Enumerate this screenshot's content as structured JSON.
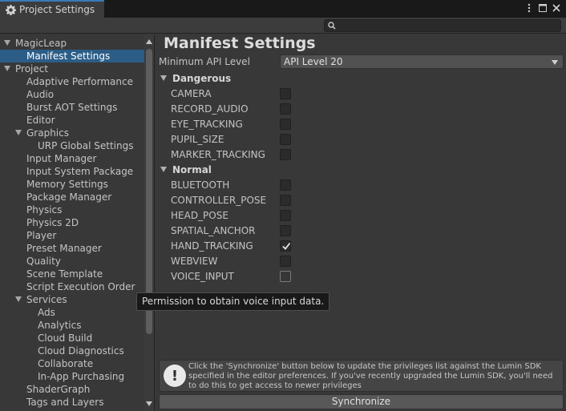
{
  "window": {
    "tab_title": "Project Settings"
  },
  "sidebar": {
    "items": [
      {
        "label": "MagicLeap",
        "indent": 0,
        "arrow": true,
        "selected": false
      },
      {
        "label": "Manifest Settings",
        "indent": 1,
        "arrow": false,
        "selected": true
      },
      {
        "label": "Project",
        "indent": 0,
        "arrow": true,
        "selected": false
      },
      {
        "label": "Adaptive Performance",
        "indent": 1,
        "arrow": false,
        "selected": false
      },
      {
        "label": "Audio",
        "indent": 1,
        "arrow": false,
        "selected": false
      },
      {
        "label": "Burst AOT Settings",
        "indent": 1,
        "arrow": false,
        "selected": false
      },
      {
        "label": "Editor",
        "indent": 1,
        "arrow": false,
        "selected": false
      },
      {
        "label": "Graphics",
        "indent": 1,
        "arrow": true,
        "selected": false
      },
      {
        "label": "URP Global Settings",
        "indent": 2,
        "arrow": false,
        "selected": false
      },
      {
        "label": "Input Manager",
        "indent": 1,
        "arrow": false,
        "selected": false
      },
      {
        "label": "Input System Package",
        "indent": 1,
        "arrow": false,
        "selected": false
      },
      {
        "label": "Memory Settings",
        "indent": 1,
        "arrow": false,
        "selected": false
      },
      {
        "label": "Package Manager",
        "indent": 1,
        "arrow": false,
        "selected": false
      },
      {
        "label": "Physics",
        "indent": 1,
        "arrow": false,
        "selected": false
      },
      {
        "label": "Physics 2D",
        "indent": 1,
        "arrow": false,
        "selected": false
      },
      {
        "label": "Player",
        "indent": 1,
        "arrow": false,
        "selected": false
      },
      {
        "label": "Preset Manager",
        "indent": 1,
        "arrow": false,
        "selected": false
      },
      {
        "label": "Quality",
        "indent": 1,
        "arrow": false,
        "selected": false
      },
      {
        "label": "Scene Template",
        "indent": 1,
        "arrow": false,
        "selected": false
      },
      {
        "label": "Script Execution Order",
        "indent": 1,
        "arrow": false,
        "selected": false
      },
      {
        "label": "Services",
        "indent": 1,
        "arrow": true,
        "selected": false
      },
      {
        "label": "Ads",
        "indent": 2,
        "arrow": false,
        "selected": false
      },
      {
        "label": "Analytics",
        "indent": 2,
        "arrow": false,
        "selected": false
      },
      {
        "label": "Cloud Build",
        "indent": 2,
        "arrow": false,
        "selected": false
      },
      {
        "label": "Cloud Diagnostics",
        "indent": 2,
        "arrow": false,
        "selected": false
      },
      {
        "label": "Collaborate",
        "indent": 2,
        "arrow": false,
        "selected": false
      },
      {
        "label": "In-App Purchasing",
        "indent": 2,
        "arrow": false,
        "selected": false
      },
      {
        "label": "ShaderGraph",
        "indent": 1,
        "arrow": false,
        "selected": false
      },
      {
        "label": "Tags and Layers",
        "indent": 1,
        "arrow": false,
        "selected": false
      }
    ]
  },
  "main": {
    "title": "Manifest Settings",
    "api_label": "Minimum API Level",
    "api_value": "API Level 20",
    "sections": [
      {
        "label": "Dangerous",
        "permissions": [
          {
            "name": "CAMERA",
            "checked": false
          },
          {
            "name": "RECORD_AUDIO",
            "checked": false
          },
          {
            "name": "EYE_TRACKING",
            "checked": false
          },
          {
            "name": "PUPIL_SIZE",
            "checked": false
          },
          {
            "name": "MARKER_TRACKING",
            "checked": false
          }
        ]
      },
      {
        "label": "Normal",
        "permissions": [
          {
            "name": "BLUETOOTH",
            "checked": false
          },
          {
            "name": "CONTROLLER_POSE",
            "checked": false
          },
          {
            "name": "HEAD_POSE",
            "checked": false
          },
          {
            "name": "SPATIAL_ANCHOR",
            "checked": false
          },
          {
            "name": "HAND_TRACKING",
            "checked": true
          },
          {
            "name": "WEBVIEW",
            "checked": false
          },
          {
            "name": "VOICE_INPUT",
            "checked": false
          }
        ]
      }
    ],
    "tooltip": "Permission to obtain voice input data.",
    "help_text": "Click the 'Synchronize' button below to update the privileges list against the Lumin SDK specified in the editor preferences. If you've recently upgraded the Lumin SDK, you'll need to do this to get access to newer privileges",
    "sync_label": "Synchronize"
  },
  "colors": {
    "background": "#383838",
    "selection": "#2c5d87",
    "accent_tab": "#3a79bb"
  }
}
